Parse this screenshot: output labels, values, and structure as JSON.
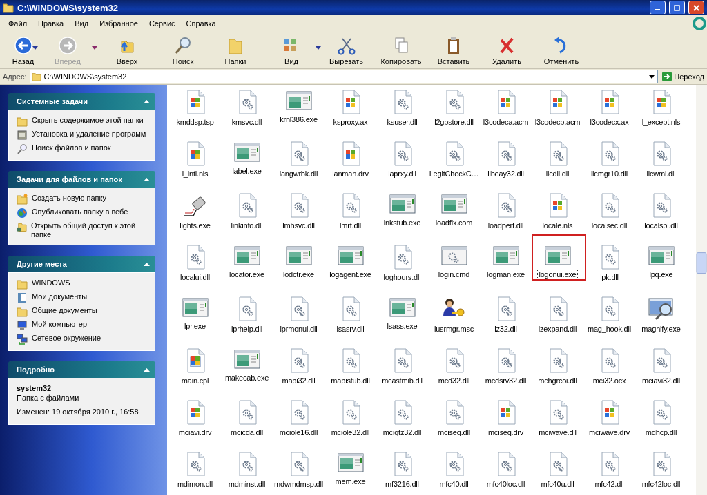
{
  "window": {
    "title": "C:\\WINDOWS\\system32"
  },
  "menu": [
    "Файл",
    "Правка",
    "Вид",
    "Избранное",
    "Сервис",
    "Справка"
  ],
  "toolbar": [
    {
      "label": "Назад",
      "kind": "back",
      "disabled": false,
      "has_dropdown": true
    },
    {
      "label": "Вперед",
      "kind": "forward",
      "disabled": true,
      "has_dropdown": true
    },
    {
      "label": "Вверх",
      "kind": "up",
      "disabled": false,
      "has_dropdown": false
    },
    {
      "label": "Поиск",
      "kind": "search",
      "disabled": false,
      "has_dropdown": false
    },
    {
      "label": "Папки",
      "kind": "folders",
      "disabled": false,
      "has_dropdown": false
    },
    {
      "label": "Вид",
      "kind": "views",
      "disabled": false,
      "has_dropdown": true
    },
    {
      "label": "Вырезать",
      "kind": "cut",
      "disabled": false,
      "has_dropdown": false
    },
    {
      "label": "Копировать",
      "kind": "copy",
      "disabled": false,
      "has_dropdown": false
    },
    {
      "label": "Вставить",
      "kind": "paste",
      "disabled": false,
      "has_dropdown": false
    },
    {
      "label": "Удалить",
      "kind": "delete",
      "disabled": false,
      "has_dropdown": false
    },
    {
      "label": "Отменить",
      "kind": "undo",
      "disabled": false,
      "has_dropdown": false
    }
  ],
  "address_bar": {
    "label": "Адрес:",
    "value": "C:\\WINDOWS\\system32",
    "go_button": "Переход"
  },
  "sidebar": [
    {
      "title": "Системные задачи",
      "items": [
        {
          "label": "Скрыть содержимое этой папки",
          "kind": "folder"
        },
        {
          "label": "Установка и удаление программ",
          "kind": "programs"
        },
        {
          "label": "Поиск файлов и папок",
          "kind": "search"
        }
      ]
    },
    {
      "title": "Задачи для файлов и папок",
      "items": [
        {
          "label": "Создать новую папку",
          "kind": "newfolder"
        },
        {
          "label": "Опубликовать папку в вебе",
          "kind": "globe"
        },
        {
          "label": "Открыть общий доступ к этой папке",
          "kind": "share"
        }
      ]
    },
    {
      "title": "Другие места",
      "items": [
        {
          "label": "WINDOWS",
          "kind": "folder"
        },
        {
          "label": "Мои документы",
          "kind": "docs"
        },
        {
          "label": "Общие документы",
          "kind": "folder"
        },
        {
          "label": "Мой компьютер",
          "kind": "computer"
        },
        {
          "label": "Сетевое окружение",
          "kind": "network"
        }
      ]
    }
  ],
  "details": {
    "title": "Подробно",
    "name": "system32",
    "type": "Папка с файлами",
    "modified": "Изменен: 19 октября 2010 г., 16:58"
  },
  "files": [
    {
      "name": "kmddsp.tsp",
      "kind": "sys",
      "selected": false
    },
    {
      "name": "kmsvc.dll",
      "kind": "dll",
      "selected": false
    },
    {
      "name": "krnl386.exe",
      "kind": "exe",
      "selected": false
    },
    {
      "name": "ksproxy.ax",
      "kind": "sys",
      "selected": false
    },
    {
      "name": "ksuser.dll",
      "kind": "dll",
      "selected": false
    },
    {
      "name": "l2gpstore.dll",
      "kind": "dll",
      "selected": false
    },
    {
      "name": "l3codeca.acm",
      "kind": "sys",
      "selected": false
    },
    {
      "name": "l3codecp.acm",
      "kind": "sys",
      "selected": false
    },
    {
      "name": "l3codecx.ax",
      "kind": "sys",
      "selected": false
    },
    {
      "name": "l_except.nls",
      "kind": "sys",
      "selected": false
    },
    {
      "name": "l_intl.nls",
      "kind": "sys",
      "selected": false
    },
    {
      "name": "label.exe",
      "kind": "exe",
      "selected": false
    },
    {
      "name": "langwrbk.dll",
      "kind": "dll",
      "selected": false
    },
    {
      "name": "lanman.drv",
      "kind": "sys",
      "selected": false
    },
    {
      "name": "laprxy.dll",
      "kind": "dll",
      "selected": false
    },
    {
      "name": "LegitCheckC…",
      "kind": "dll",
      "selected": false
    },
    {
      "name": "libeay32.dll",
      "kind": "dll",
      "selected": false
    },
    {
      "name": "licdll.dll",
      "kind": "dll",
      "selected": false
    },
    {
      "name": "licmgr10.dll",
      "kind": "dll",
      "selected": false
    },
    {
      "name": "licwmi.dll",
      "kind": "dll",
      "selected": false
    },
    {
      "name": "lights.exe",
      "kind": "lights",
      "selected": false
    },
    {
      "name": "linkinfo.dll",
      "kind": "dll",
      "selected": false
    },
    {
      "name": "lmhsvc.dll",
      "kind": "dll",
      "selected": false
    },
    {
      "name": "lmrt.dll",
      "kind": "dll",
      "selected": false
    },
    {
      "name": "lnkstub.exe",
      "kind": "exe",
      "selected": false
    },
    {
      "name": "loadfix.com",
      "kind": "exe",
      "selected": false
    },
    {
      "name": "loadperf.dll",
      "kind": "dll",
      "selected": false
    },
    {
      "name": "locale.nls",
      "kind": "sys",
      "selected": false
    },
    {
      "name": "localsec.dll",
      "kind": "dll",
      "selected": false
    },
    {
      "name": "localspl.dll",
      "kind": "dll",
      "selected": false
    },
    {
      "name": "localui.dll",
      "kind": "dll",
      "selected": false
    },
    {
      "name": "locator.exe",
      "kind": "exe",
      "selected": false
    },
    {
      "name": "lodctr.exe",
      "kind": "exe",
      "selected": false
    },
    {
      "name": "logagent.exe",
      "kind": "exe",
      "selected": false
    },
    {
      "name": "loghours.dll",
      "kind": "dll",
      "selected": false
    },
    {
      "name": "login.cmd",
      "kind": "cmd",
      "selected": false
    },
    {
      "name": "logman.exe",
      "kind": "exe",
      "selected": false
    },
    {
      "name": "logonui.exe",
      "kind": "exe",
      "selected": true
    },
    {
      "name": "lpk.dll",
      "kind": "dll",
      "selected": false
    },
    {
      "name": "lpq.exe",
      "kind": "exe",
      "selected": false
    },
    {
      "name": "lpr.exe",
      "kind": "exe",
      "selected": false
    },
    {
      "name": "lprhelp.dll",
      "kind": "dll",
      "selected": false
    },
    {
      "name": "lprmonui.dll",
      "kind": "dll",
      "selected": false
    },
    {
      "name": "lsasrv.dll",
      "kind": "dll",
      "selected": false
    },
    {
      "name": "lsass.exe",
      "kind": "exe",
      "selected": false
    },
    {
      "name": "lusrmgr.msc",
      "kind": "msc",
      "selected": false
    },
    {
      "name": "lz32.dll",
      "kind": "dll",
      "selected": false
    },
    {
      "name": "lzexpand.dll",
      "kind": "dll",
      "selected": false
    },
    {
      "name": "mag_hook.dll",
      "kind": "dll",
      "selected": false
    },
    {
      "name": "magnify.exe",
      "kind": "magnify",
      "selected": false
    },
    {
      "name": "main.cpl",
      "kind": "cpl",
      "selected": false
    },
    {
      "name": "makecab.exe",
      "kind": "exe",
      "selected": false
    },
    {
      "name": "mapi32.dll",
      "kind": "dll",
      "selected": false
    },
    {
      "name": "mapistub.dll",
      "kind": "dll",
      "selected": false
    },
    {
      "name": "mcastmib.dll",
      "kind": "dll",
      "selected": false
    },
    {
      "name": "mcd32.dll",
      "kind": "dll",
      "selected": false
    },
    {
      "name": "mcdsrv32.dll",
      "kind": "dll",
      "selected": false
    },
    {
      "name": "mchgrcoi.dll",
      "kind": "dll",
      "selected": false
    },
    {
      "name": "mci32.ocx",
      "kind": "dll",
      "selected": false
    },
    {
      "name": "mciavi32.dll",
      "kind": "dll",
      "selected": false
    },
    {
      "name": "mciavi.drv",
      "kind": "sys",
      "selected": false
    },
    {
      "name": "mcicda.dll",
      "kind": "dll",
      "selected": false
    },
    {
      "name": "mciole16.dll",
      "kind": "dll",
      "selected": false
    },
    {
      "name": "mciole32.dll",
      "kind": "dll",
      "selected": false
    },
    {
      "name": "mciqtz32.dll",
      "kind": "dll",
      "selected": false
    },
    {
      "name": "mciseq.dll",
      "kind": "dll",
      "selected": false
    },
    {
      "name": "mciseq.drv",
      "kind": "sys",
      "selected": false
    },
    {
      "name": "mciwave.dll",
      "kind": "dll",
      "selected": false
    },
    {
      "name": "mciwave.drv",
      "kind": "sys",
      "selected": false
    },
    {
      "name": "mdhcp.dll",
      "kind": "dll",
      "selected": false
    },
    {
      "name": "mdimon.dll",
      "kind": "dll",
      "selected": false
    },
    {
      "name": "mdminst.dll",
      "kind": "dll",
      "selected": false
    },
    {
      "name": "mdwmdmsp.dll",
      "kind": "dll",
      "selected": false
    },
    {
      "name": "mem.exe",
      "kind": "exe",
      "selected": false
    },
    {
      "name": "mf3216.dll",
      "kind": "dll",
      "selected": false
    },
    {
      "name": "mfc40.dll",
      "kind": "dll",
      "selected": false
    },
    {
      "name": "mfc40loc.dll",
      "kind": "dll",
      "selected": false
    },
    {
      "name": "mfc40u.dll",
      "kind": "dll",
      "selected": false
    },
    {
      "name": "mfc42.dll",
      "kind": "dll",
      "selected": false
    },
    {
      "name": "mfc42loc.dll",
      "kind": "dll",
      "selected": false
    }
  ]
}
